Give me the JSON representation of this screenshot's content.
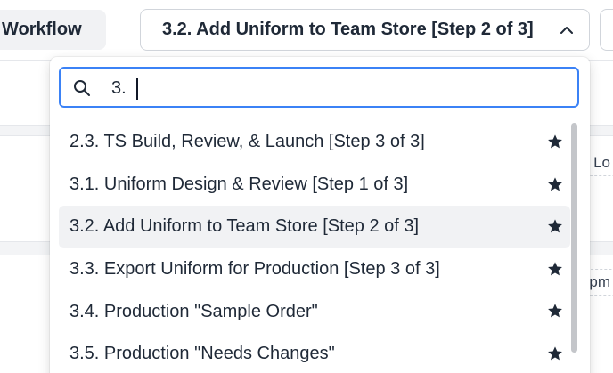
{
  "toolbar": {
    "workflow_label": "Workflow",
    "current_step": "3.2. Add Uniform to Team Store [Step 2 of 3]"
  },
  "background": {
    "peek_1": "Lo",
    "peek_2": "pm"
  },
  "dropdown": {
    "search_value": "3.",
    "items": [
      {
        "label": "2.3. TS Build, Review, & Launch [Step 3 of 3]",
        "icon": "star-icon"
      },
      {
        "label": "3.1. Uniform Design & Review [Step 1 of 3]",
        "icon": "star-icon"
      },
      {
        "label": "3.2. Add Uniform to Team Store [Step 2 of 3]",
        "icon": "star-icon",
        "selected": true
      },
      {
        "label": "3.3. Export Uniform for Production [Step 3 of 3]",
        "icon": "star-icon"
      },
      {
        "label": "3.4. Production \"Sample Order\"",
        "icon": "star-icon"
      },
      {
        "label": "3.5. Production \"Needs Changes\"",
        "icon": "star-icon"
      }
    ]
  },
  "colors": {
    "focus_border": "#3b82f6",
    "selected_bg": "#f1f2f4",
    "text": "#1f2937"
  }
}
